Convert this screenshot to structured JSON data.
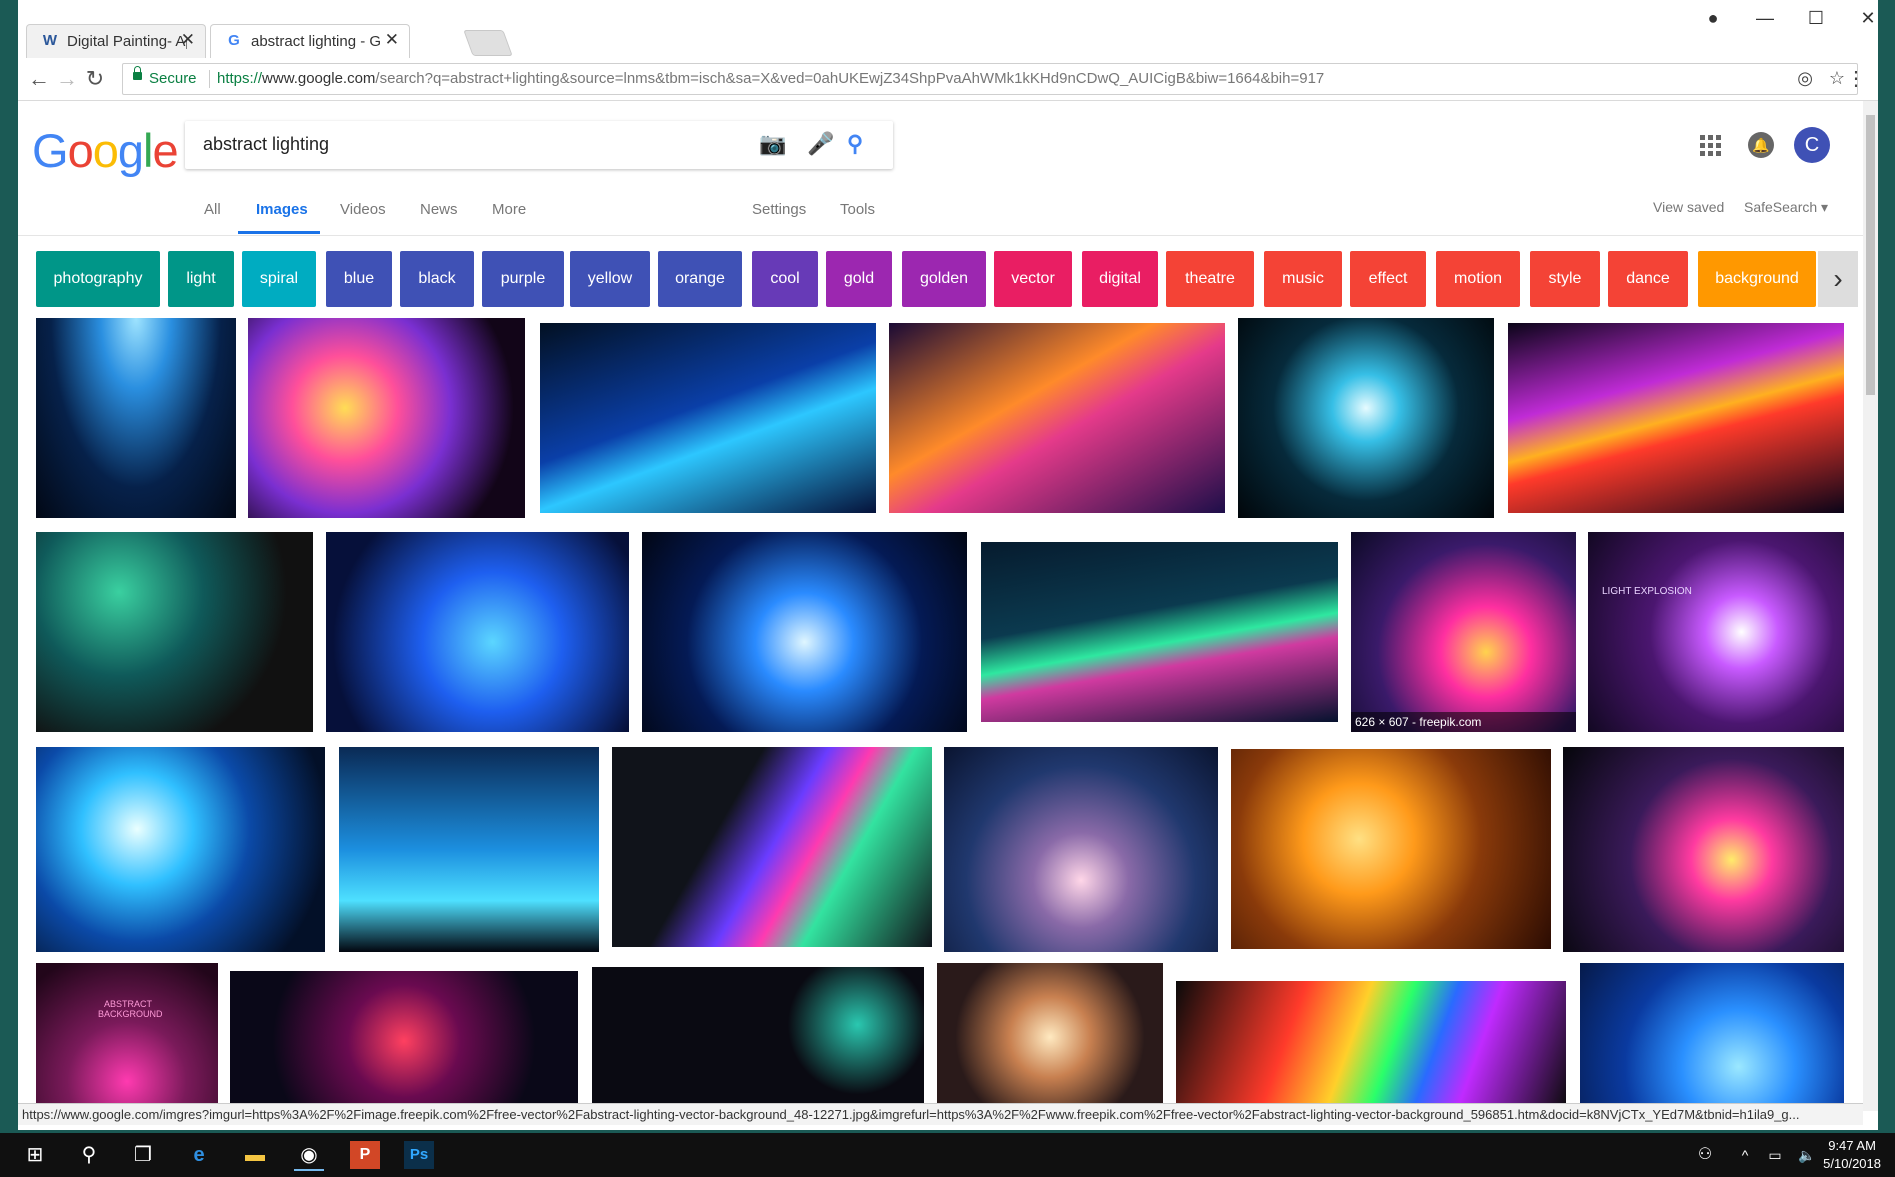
{
  "browser": {
    "tabs": [
      {
        "title": "Digital Painting- Apple/S",
        "favicon": "W",
        "favicon_color": "#2b579a"
      },
      {
        "title": "abstract lighting - Googl",
        "favicon": "G",
        "favicon_color": "#4285f4"
      }
    ],
    "address": {
      "secure_label": "Secure",
      "scheme": "https://",
      "host": "www.google.com",
      "path": "/search?q=abstract+lighting&source=lnms&tbm=isch&sa=X&ved=0ahUKEwjZ34ShpPvaAhWMk1kKHd9nCDwQ_AUICigB&biw=1664&bih=917"
    },
    "status_url": "https://www.google.com/imgres?imgurl=https%3A%2F%2Fimage.freepik.com%2Ffree-vector%2Fabstract-lighting-vector-background_48-12271.jpg&imgrefurl=https%3A%2F%2Fwww.freepik.com%2Ffree-vector%2Fabstract-lighting-vector-background_596851.htm&docid=k8NVjCTx_YEd7M&tbnid=h1ila9_g..."
  },
  "google": {
    "logo_letters": [
      {
        "char": "G",
        "color": "#4285f4"
      },
      {
        "char": "o",
        "color": "#ea4335"
      },
      {
        "char": "o",
        "color": "#fbbc05"
      },
      {
        "char": "g",
        "color": "#4285f4"
      },
      {
        "char": "l",
        "color": "#34a853"
      },
      {
        "char": "e",
        "color": "#ea4335"
      }
    ],
    "query": "abstract lighting",
    "avatar_initial": "C",
    "nav_tabs": [
      "All",
      "Images",
      "Videos",
      "News",
      "More"
    ],
    "active_tab": "Images",
    "settings": "Settings",
    "tools": "Tools",
    "view_saved": "View saved",
    "safesearch": "SafeSearch ▾",
    "chips": [
      {
        "label": "photography",
        "color": "#009688"
      },
      {
        "label": "light",
        "color": "#009688"
      },
      {
        "label": "spiral",
        "color": "#00acc1"
      },
      {
        "label": "blue",
        "color": "#3f51b5"
      },
      {
        "label": "black",
        "color": "#3f51b5"
      },
      {
        "label": "purple",
        "color": "#3f51b5"
      },
      {
        "label": "yellow",
        "color": "#3f51b5"
      },
      {
        "label": "orange",
        "color": "#3f51b5"
      },
      {
        "label": "cool",
        "color": "#673ab7"
      },
      {
        "label": "gold",
        "color": "#9c27b0"
      },
      {
        "label": "golden",
        "color": "#9c27b0"
      },
      {
        "label": "vector",
        "color": "#e91e63"
      },
      {
        "label": "digital",
        "color": "#e91e63"
      },
      {
        "label": "theatre",
        "color": "#f44336"
      },
      {
        "label": "music",
        "color": "#f44336"
      },
      {
        "label": "effect",
        "color": "#f44336"
      },
      {
        "label": "motion",
        "color": "#f44336"
      },
      {
        "label": "style",
        "color": "#f44336"
      },
      {
        "label": "dance",
        "color": "#f44336"
      },
      {
        "label": "background",
        "color": "#ff9800"
      }
    ],
    "hover_caption": "626 × 607 - freepik.com",
    "thumb_overlay_texts": [
      "LIGHT EXPLOSION",
      "ABSTRACT BACKGROUND"
    ]
  },
  "taskbar": {
    "time": "9:47 AM",
    "date": "5/10/2018"
  }
}
